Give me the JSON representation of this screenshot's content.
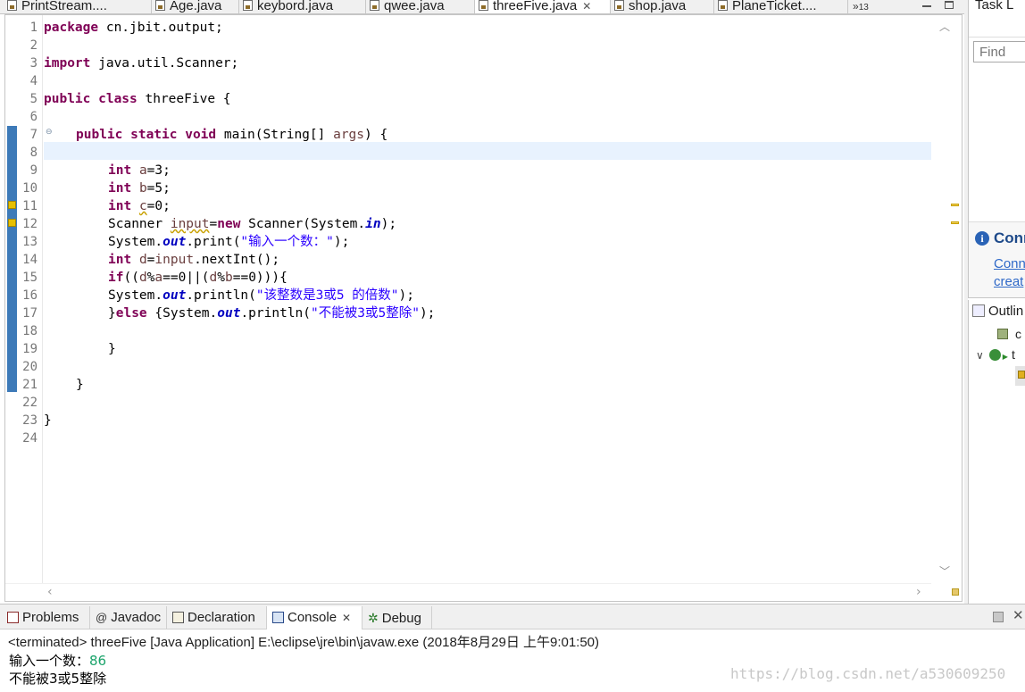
{
  "editor_tabs": [
    {
      "label": "PrintStream...."
    },
    {
      "label": "Age.java"
    },
    {
      "label": "keybord.java"
    },
    {
      "label": "qwee.java"
    },
    {
      "label": "threeFive.java"
    },
    {
      "label": "shop.java"
    },
    {
      "label": "PlaneTicket...."
    }
  ],
  "tab_overflow": {
    "count": "13"
  },
  "code": {
    "line_numbers": [
      "1",
      "2",
      "3",
      "4",
      "5",
      "6",
      "7",
      "8",
      "9",
      "10",
      "11",
      "12",
      "13",
      "14",
      "15",
      "16",
      "17",
      "18",
      "19",
      "20",
      "21",
      "22",
      "23",
      "24"
    ],
    "lines": {
      "package_kw": "package",
      "package_rest": " cn.jbit.output;",
      "import_kw": "import",
      "import_rest": " java.util.Scanner;",
      "class_kw": "public class",
      "class_rest": " threeFive {",
      "main_kw": "public static void",
      "main_sig": " main(String[] ",
      "main_args": "args",
      "main_end": ") {",
      "int_kw": "int",
      "a_decl": "a",
      "a_val": "=3;",
      "b_decl": "b",
      "b_val": "=5;",
      "c_decl": "c",
      "c_val": "=0;",
      "scanner_type": "Scanner ",
      "scanner_var": "input",
      "scanner_eq": "=",
      "new_kw": "new",
      "scanner_ctor": " Scanner(System.",
      "in_field": "in",
      "scanner_end": ");",
      "sys": "System.",
      "out_field": "out",
      "print_call": ".print(",
      "print_str": "\"输入一个数：\"",
      "call_end": ");",
      "d_decl": "d",
      "d_eq": "=",
      "d_input": "input",
      "d_rest": ".nextInt();",
      "if_kw": "if",
      "if_open": "((",
      "d_ref": "d",
      "mod_op": "%",
      "a_ref": "a",
      "if_eq0": "==0||(",
      "d_ref2": "d",
      "mod_op2": "%",
      "b_ref": "b",
      "if_close": "==0))){",
      "println_call": ".println(",
      "println_str1": "\"该整数是3或5 的倍数\"",
      "else_brace": "}",
      "else_kw": "else",
      "else_sys": " {System.",
      "println_str2": "\"不能被3或5整除\"",
      "close_19": "}",
      "close_21": "}",
      "close_23": "}"
    }
  },
  "right": {
    "task_title": "Task L",
    "find_placeholder": "Find",
    "connect_title": "Conn",
    "connect_link1": "Conn",
    "connect_link2": "creat",
    "outline_title": "Outlin",
    "outline_item1": "c",
    "outline_item2": "t"
  },
  "bottom": {
    "tabs": [
      {
        "label": "Problems"
      },
      {
        "label": "Javadoc"
      },
      {
        "label": "Declaration"
      },
      {
        "label": "Console"
      },
      {
        "label": "Debug"
      }
    ],
    "console_header": "<terminated> threeFive [Java Application] E:\\eclipse\\jre\\bin\\javaw.exe (2018年8月29日 上午9:01:50)",
    "console_prompt": "输入一个数：",
    "console_input": "86",
    "console_output": "不能被3或5整除",
    "watermark": "https://blog.csdn.net/a530609250"
  }
}
